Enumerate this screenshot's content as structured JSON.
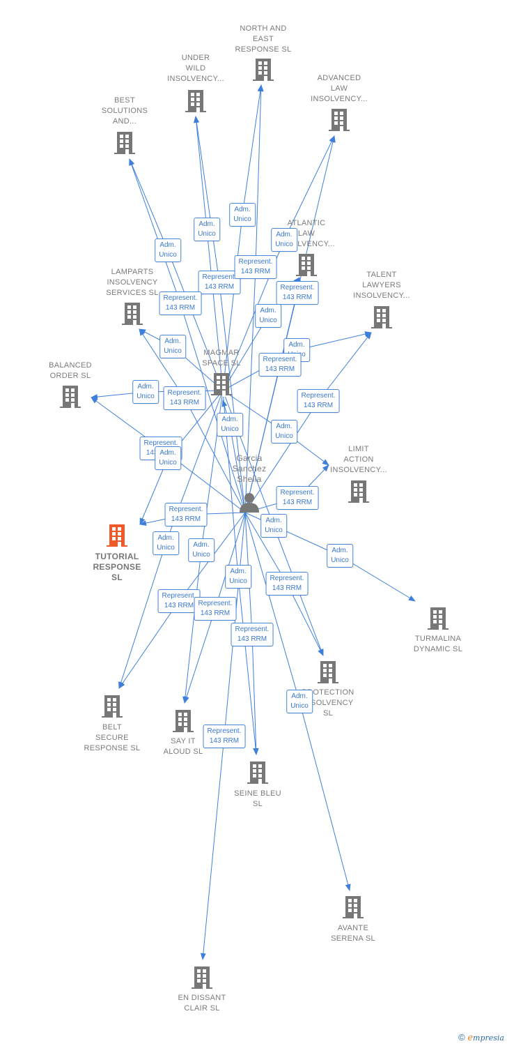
{
  "colors": {
    "edge": "#3f7fdc",
    "node": "#777777",
    "highlight": "#f05a28"
  },
  "nodes": [
    {
      "id": "north",
      "type": "company",
      "label": [
        "NORTH AND",
        "EAST",
        "RESPONSE  SL"
      ]
    },
    {
      "id": "underwild",
      "type": "company",
      "label": [
        "UNDER",
        "WILD",
        "INSOLVENCY..."
      ]
    },
    {
      "id": "advanced",
      "type": "company",
      "label": [
        "ADVANCED",
        "LAW",
        "INSOLVENCY..."
      ]
    },
    {
      "id": "best",
      "type": "company",
      "label": [
        "BEST",
        "SOLUTIONS",
        "AND..."
      ]
    },
    {
      "id": "atlantic",
      "type": "company",
      "label": [
        "ATLANTIC",
        "LAW",
        "INSOLVENCY..."
      ]
    },
    {
      "id": "lamparts",
      "type": "company",
      "label": [
        "LAMPARTS",
        "INSOLVENCY",
        "SERVICES  SL"
      ]
    },
    {
      "id": "talent",
      "type": "company",
      "label": [
        "TALENT",
        "LAWYERS",
        "INSOLVENCY..."
      ]
    },
    {
      "id": "magmar",
      "type": "company",
      "label": [
        "MAGMAR",
        "SPACE  SL"
      ]
    },
    {
      "id": "balanced",
      "type": "company",
      "label": [
        "BALANCED",
        "ORDER  SL"
      ]
    },
    {
      "id": "limit",
      "type": "company",
      "label": [
        "LIMIT",
        "ACTION",
        "INSOLVENCY..."
      ]
    },
    {
      "id": "person",
      "type": "person",
      "label": [
        "Garcia",
        "Sanchez",
        "Sheila"
      ]
    },
    {
      "id": "tutorial",
      "type": "company",
      "highlight": true,
      "label": [
        "TUTORIAL",
        "RESPONSE",
        "SL"
      ]
    },
    {
      "id": "turmalina",
      "type": "company",
      "label": [
        "TURMALINA",
        "DYNAMIC  SL"
      ]
    },
    {
      "id": "protection",
      "type": "company",
      "label": [
        "PROTECTION",
        "INSOLVENCY",
        "SL"
      ]
    },
    {
      "id": "belt",
      "type": "company",
      "label": [
        "BELT",
        "SECURE",
        "RESPONSE  SL"
      ]
    },
    {
      "id": "sayit",
      "type": "company",
      "label": [
        "SAY IT",
        "ALOUD  SL"
      ]
    },
    {
      "id": "seine",
      "type": "company",
      "label": [
        "SEINE BLEU",
        "SL"
      ]
    },
    {
      "id": "avante",
      "type": "company",
      "label": [
        "AVANTE",
        "SERENA  SL"
      ]
    },
    {
      "id": "endissant",
      "type": "company",
      "label": [
        "EN DISSANT",
        "CLAIR  SL"
      ]
    }
  ],
  "edges": [
    {
      "from": "magmar",
      "to": "underwild",
      "label": [
        "Adm.",
        "Unico"
      ]
    },
    {
      "from": "magmar",
      "to": "north",
      "label": [
        "Adm.",
        "Unico"
      ]
    },
    {
      "from": "magmar",
      "to": "advanced",
      "label": [
        "Adm.",
        "Unico"
      ]
    },
    {
      "from": "magmar",
      "to": "best",
      "label": [
        "Adm.",
        "Unico"
      ]
    },
    {
      "from": "person",
      "to": "underwild",
      "label": [
        "Represent.",
        "143 RRM"
      ]
    },
    {
      "from": "person",
      "to": "north",
      "label": [
        "Represent.",
        "143 RRM"
      ]
    },
    {
      "from": "person",
      "to": "atlantic",
      "label": [
        "Represent.",
        "143 RRM"
      ]
    },
    {
      "from": "person",
      "to": "best",
      "label": [
        "Represent.",
        "143 RRM"
      ]
    },
    {
      "from": "magmar",
      "to": "atlantic",
      "label": [
        "Adm.",
        "Unico"
      ]
    },
    {
      "from": "magmar",
      "to": "lamparts",
      "label": [
        "Adm.",
        "Unico"
      ]
    },
    {
      "from": "magmar",
      "to": "talent",
      "label": [
        "Adm.",
        "Unico"
      ]
    },
    {
      "from": "person",
      "to": "advanced",
      "label": [
        "Represent.",
        "143 RRM"
      ]
    },
    {
      "from": "magmar",
      "to": "balanced",
      "label": [
        "Adm.",
        "Unico"
      ]
    },
    {
      "from": "person",
      "to": "lamparts",
      "label": [
        "Represent.",
        "143 RRM"
      ]
    },
    {
      "from": "person",
      "to": "magmar",
      "label": [
        "Adm.",
        "Unico"
      ]
    },
    {
      "from": "person",
      "to": "talent",
      "label": [
        "Represent.",
        "143 RRM"
      ]
    },
    {
      "from": "person",
      "to": "balanced",
      "label": [
        "Represent.",
        "143 RRM"
      ]
    },
    {
      "from": "magmar",
      "to": "tutorial",
      "label": [
        "Adm.",
        "Unico"
      ]
    },
    {
      "from": "magmar",
      "to": "limit",
      "label": [
        "Adm.",
        "Unico"
      ]
    },
    {
      "from": "person",
      "to": "limit",
      "label": [
        "Represent.",
        "143 RRM"
      ]
    },
    {
      "from": "person",
      "to": "tutorial",
      "label": [
        "Represent.",
        "143 RRM"
      ]
    },
    {
      "from": "magmar",
      "to": "protection",
      "label": [
        "Adm.",
        "Unico"
      ]
    },
    {
      "from": "magmar",
      "to": "belt",
      "label": [
        "Adm.",
        "Unico"
      ]
    },
    {
      "from": "magmar",
      "to": "sayit",
      "label": [
        "Adm.",
        "Unico"
      ]
    },
    {
      "from": "person",
      "to": "turmalina",
      "label": [
        "Adm.",
        "Unico"
      ]
    },
    {
      "from": "magmar",
      "to": "seine",
      "label": [
        "Adm.",
        "Unico"
      ]
    },
    {
      "from": "person",
      "to": "protection",
      "label": [
        "Represent.",
        "143 RRM"
      ]
    },
    {
      "from": "person",
      "to": "belt",
      "label": [
        "Represent.",
        "143 RRM"
      ]
    },
    {
      "from": "person",
      "to": "sayit",
      "label": [
        "Represent.",
        "143 RRM"
      ]
    },
    {
      "from": "person",
      "to": "seine",
      "label": [
        "Represent.",
        "143 RRM"
      ]
    },
    {
      "from": "person",
      "to": "avante",
      "label": [
        "Adm.",
        "Unico"
      ]
    },
    {
      "from": "person",
      "to": "endissant",
      "label": [
        "Represent.",
        "143 RRM"
      ]
    }
  ],
  "footer": {
    "copyright": "©",
    "brand_initial": "e",
    "brand_rest": "mpresia"
  }
}
